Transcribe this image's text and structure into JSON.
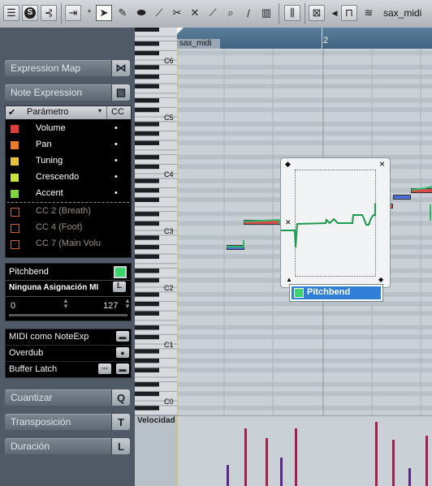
{
  "toolbar": {
    "part_name": "sax_midi",
    "icons": [
      "panel-icon",
      "solo-icon",
      "feedback-icon",
      "autoscroll-icon",
      "pointer-icon",
      "pencil-icon",
      "eraser-icon",
      "knife-icon",
      "glue-icon",
      "mute-icon",
      "line-icon",
      "zoom-icon",
      "line-tool-icon",
      "time-warp-icon",
      "quantize-icon",
      "snap-icon",
      "part-list-icon"
    ]
  },
  "inspector": {
    "expression_map": "Expression Map",
    "note_expression": "Note Expression",
    "param_header": {
      "col_param": "Parámetro",
      "col_cc": "CC"
    },
    "params": [
      {
        "name": "Volume",
        "color": "#e23b3b",
        "dot": "•"
      },
      {
        "name": "Pan",
        "color": "#ea7d28",
        "dot": "•"
      },
      {
        "name": "Tuning",
        "color": "#e3c23a",
        "dot": "•"
      },
      {
        "name": "Crescendo",
        "color": "#c9e33a",
        "dot": "•"
      },
      {
        "name": "Accent",
        "color": "#7fd63c",
        "dot": "•"
      }
    ],
    "cc_params": [
      {
        "name": "CC 2  (Breath)"
      },
      {
        "name": "CC 4  (Foot)"
      },
      {
        "name": "CC 7  (Main Volu"
      }
    ],
    "pitchbend": {
      "label": "Pitchbend",
      "assignment": "Ninguna Asignación MI",
      "min": "0",
      "max": "127"
    },
    "toggles": [
      {
        "label": "MIDI como NoteExp",
        "btn": "▬"
      },
      {
        "label": "Overdub",
        "btn": "●"
      },
      {
        "label": "Buffer Latch",
        "btn": "▬"
      }
    ],
    "sections": [
      {
        "label": "Cuantizar",
        "btn": "Q"
      },
      {
        "label": "Transposición",
        "btn": "T"
      },
      {
        "label": "Duración",
        "btn": "L"
      }
    ]
  },
  "ruler": {
    "part": "sax_midi",
    "bar2": "2"
  },
  "keys": [
    "C6",
    "C5",
    "C4",
    "C3",
    "C2",
    "C1",
    "C0"
  ],
  "popup": {
    "label": "Pitchbend",
    "close": "×",
    "diamond": "◆"
  },
  "velocity_label": "Velocidad"
}
